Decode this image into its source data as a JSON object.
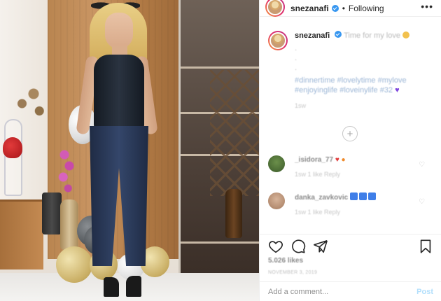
{
  "header": {
    "username": "snezanafi",
    "separator": "•",
    "follow_state": "Following",
    "more": "•••"
  },
  "caption": {
    "username": "snezanafi",
    "text": "Time for my love",
    "dots": [
      ".",
      ".",
      "."
    ],
    "hashtags": "#dinnertime #lovelytime #mylove #enjoyinglife #loveinylife #32",
    "time": "1sw"
  },
  "load_more": "+",
  "comments": [
    {
      "username": "_isidora_77",
      "meta": "1sw   1 like   Reply"
    },
    {
      "username": "danka_zavkovic",
      "meta": "1sw   1 like   Reply"
    }
  ],
  "likes": "5.026 likes",
  "date": "NOVEMBER 3, 2019",
  "add_comment": {
    "placeholder": "Add a comment...",
    "post_label": "Post"
  },
  "icons": [
    "heart-icon",
    "comment-icon",
    "share-icon",
    "bookmark-icon",
    "verified-icon",
    "more-options-icon",
    "load-more-comments-icon"
  ],
  "colors": {
    "verified_blue": "#3897f0",
    "post_button": "#b2dffc",
    "text_primary": "#262626",
    "text_secondary": "#8e8e8e"
  }
}
